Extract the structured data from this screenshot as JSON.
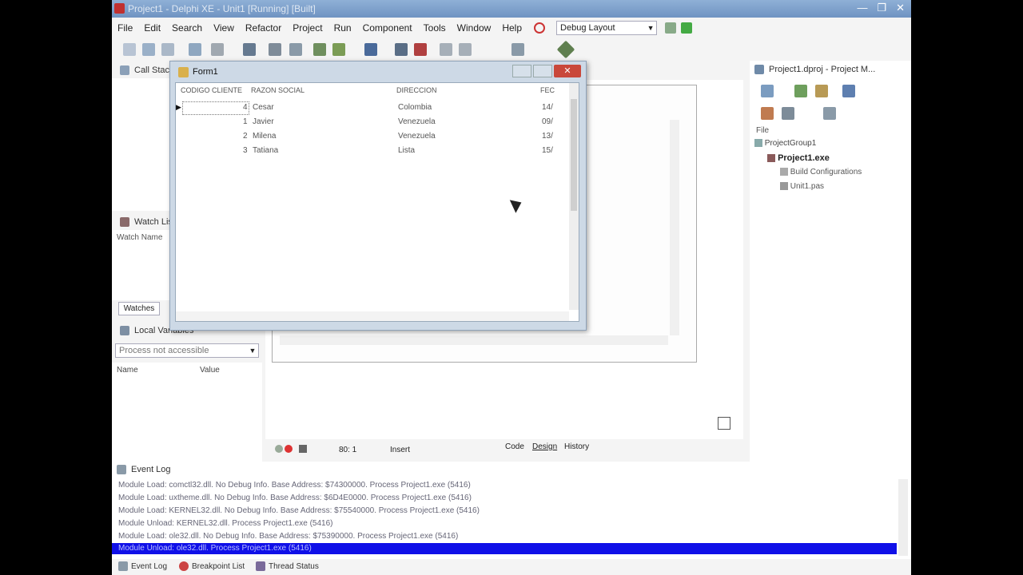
{
  "window": {
    "title": "Project1 - Delphi XE - Unit1 [Running] [Built]",
    "controls": [
      "—",
      "❐",
      "✕"
    ]
  },
  "menu": [
    "File",
    "Edit",
    "Search",
    "View",
    "Refactor",
    "Project",
    "Run",
    "Component",
    "Tools",
    "Window",
    "Help"
  ],
  "layout_combo": "Debug Layout",
  "panels": {
    "call_stack": "Call Stack",
    "watch_list": "Watch List",
    "watch_col": "Watch Name",
    "watches_tab": "Watches",
    "local_vars": "Local Variables",
    "local_combo": "Process not accessible",
    "local_cols": [
      "Name",
      "Value"
    ]
  },
  "project_manager": {
    "title": "Project1.dproj - Project M...",
    "file_label": "File",
    "tree": [
      "ProjectGroup1",
      "Project1.exe",
      "Build Configurations",
      "Unit1.pas"
    ]
  },
  "form1": {
    "title": "Form1",
    "columns": [
      "CODIGO CLIENTE",
      "RAZON SOCIAL",
      "DIRECCION",
      "FEC"
    ],
    "rows": [
      {
        "id": "4",
        "name": "Cesar",
        "address": "Colombia",
        "date": "14/"
      },
      {
        "id": "1",
        "name": "Javier",
        "address": "Venezuela",
        "date": "09/"
      },
      {
        "id": "2",
        "name": "Milena",
        "address": "Venezuela",
        "date": "13/"
      },
      {
        "id": "3",
        "name": "Tatiana",
        "address": "Lista",
        "date": "15/"
      }
    ]
  },
  "editor_status": {
    "position": "80:  1",
    "mode": "Insert",
    "tabs": [
      "Code",
      "Design",
      "History"
    ]
  },
  "event_log": {
    "title": "Event Log",
    "lines": [
      "Module Load: comctl32.dll. No Debug Info. Base Address: $74300000. Process Project1.exe (5416)",
      "Module Load: uxtheme.dll. No Debug Info. Base Address: $6D4E0000. Process Project1.exe (5416)",
      "Module Load: KERNEL32.dll. No Debug Info. Base Address: $75540000. Process Project1.exe (5416)",
      "Module Unload: KERNEL32.dll. Process Project1.exe (5416)",
      "Module Load: ole32.dll. No Debug Info. Base Address: $75390000. Process Project1.exe (5416)",
      "Module Unload: ole32.dll. Process Project1.exe (5416)"
    ]
  },
  "bottom_tabs": [
    "Event Log",
    "Breakpoint List",
    "Thread Status"
  ],
  "colors": {
    "titlebar": "#7a9cc8",
    "selection": "#1010e8",
    "form_bg": "#cdd9e6"
  }
}
